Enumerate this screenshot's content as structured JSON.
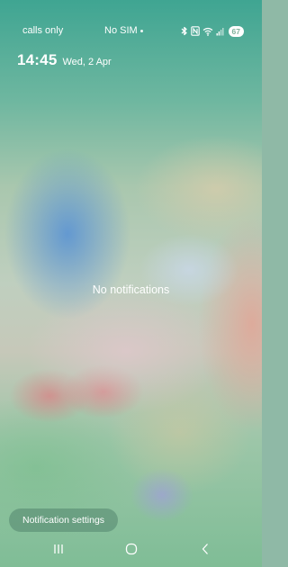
{
  "status_bar": {
    "carrier": "calls only",
    "sim": "No SIM",
    "battery": "67",
    "icons": [
      "bluetooth-icon",
      "nfc-icon",
      "wifi-icon",
      "signal-icon"
    ]
  },
  "lock_header": {
    "time": "14:45",
    "date": "Wed, 2 Apr"
  },
  "notifications": {
    "empty_message": "No notifications",
    "settings_button": "Notification settings"
  },
  "nav_bar": {
    "icons": [
      "recents-icon",
      "home-icon",
      "back-icon"
    ]
  },
  "colors": {
    "text": "#ffffff",
    "battery_fill": "#ffffff",
    "battery_text": "#7fb29c"
  }
}
